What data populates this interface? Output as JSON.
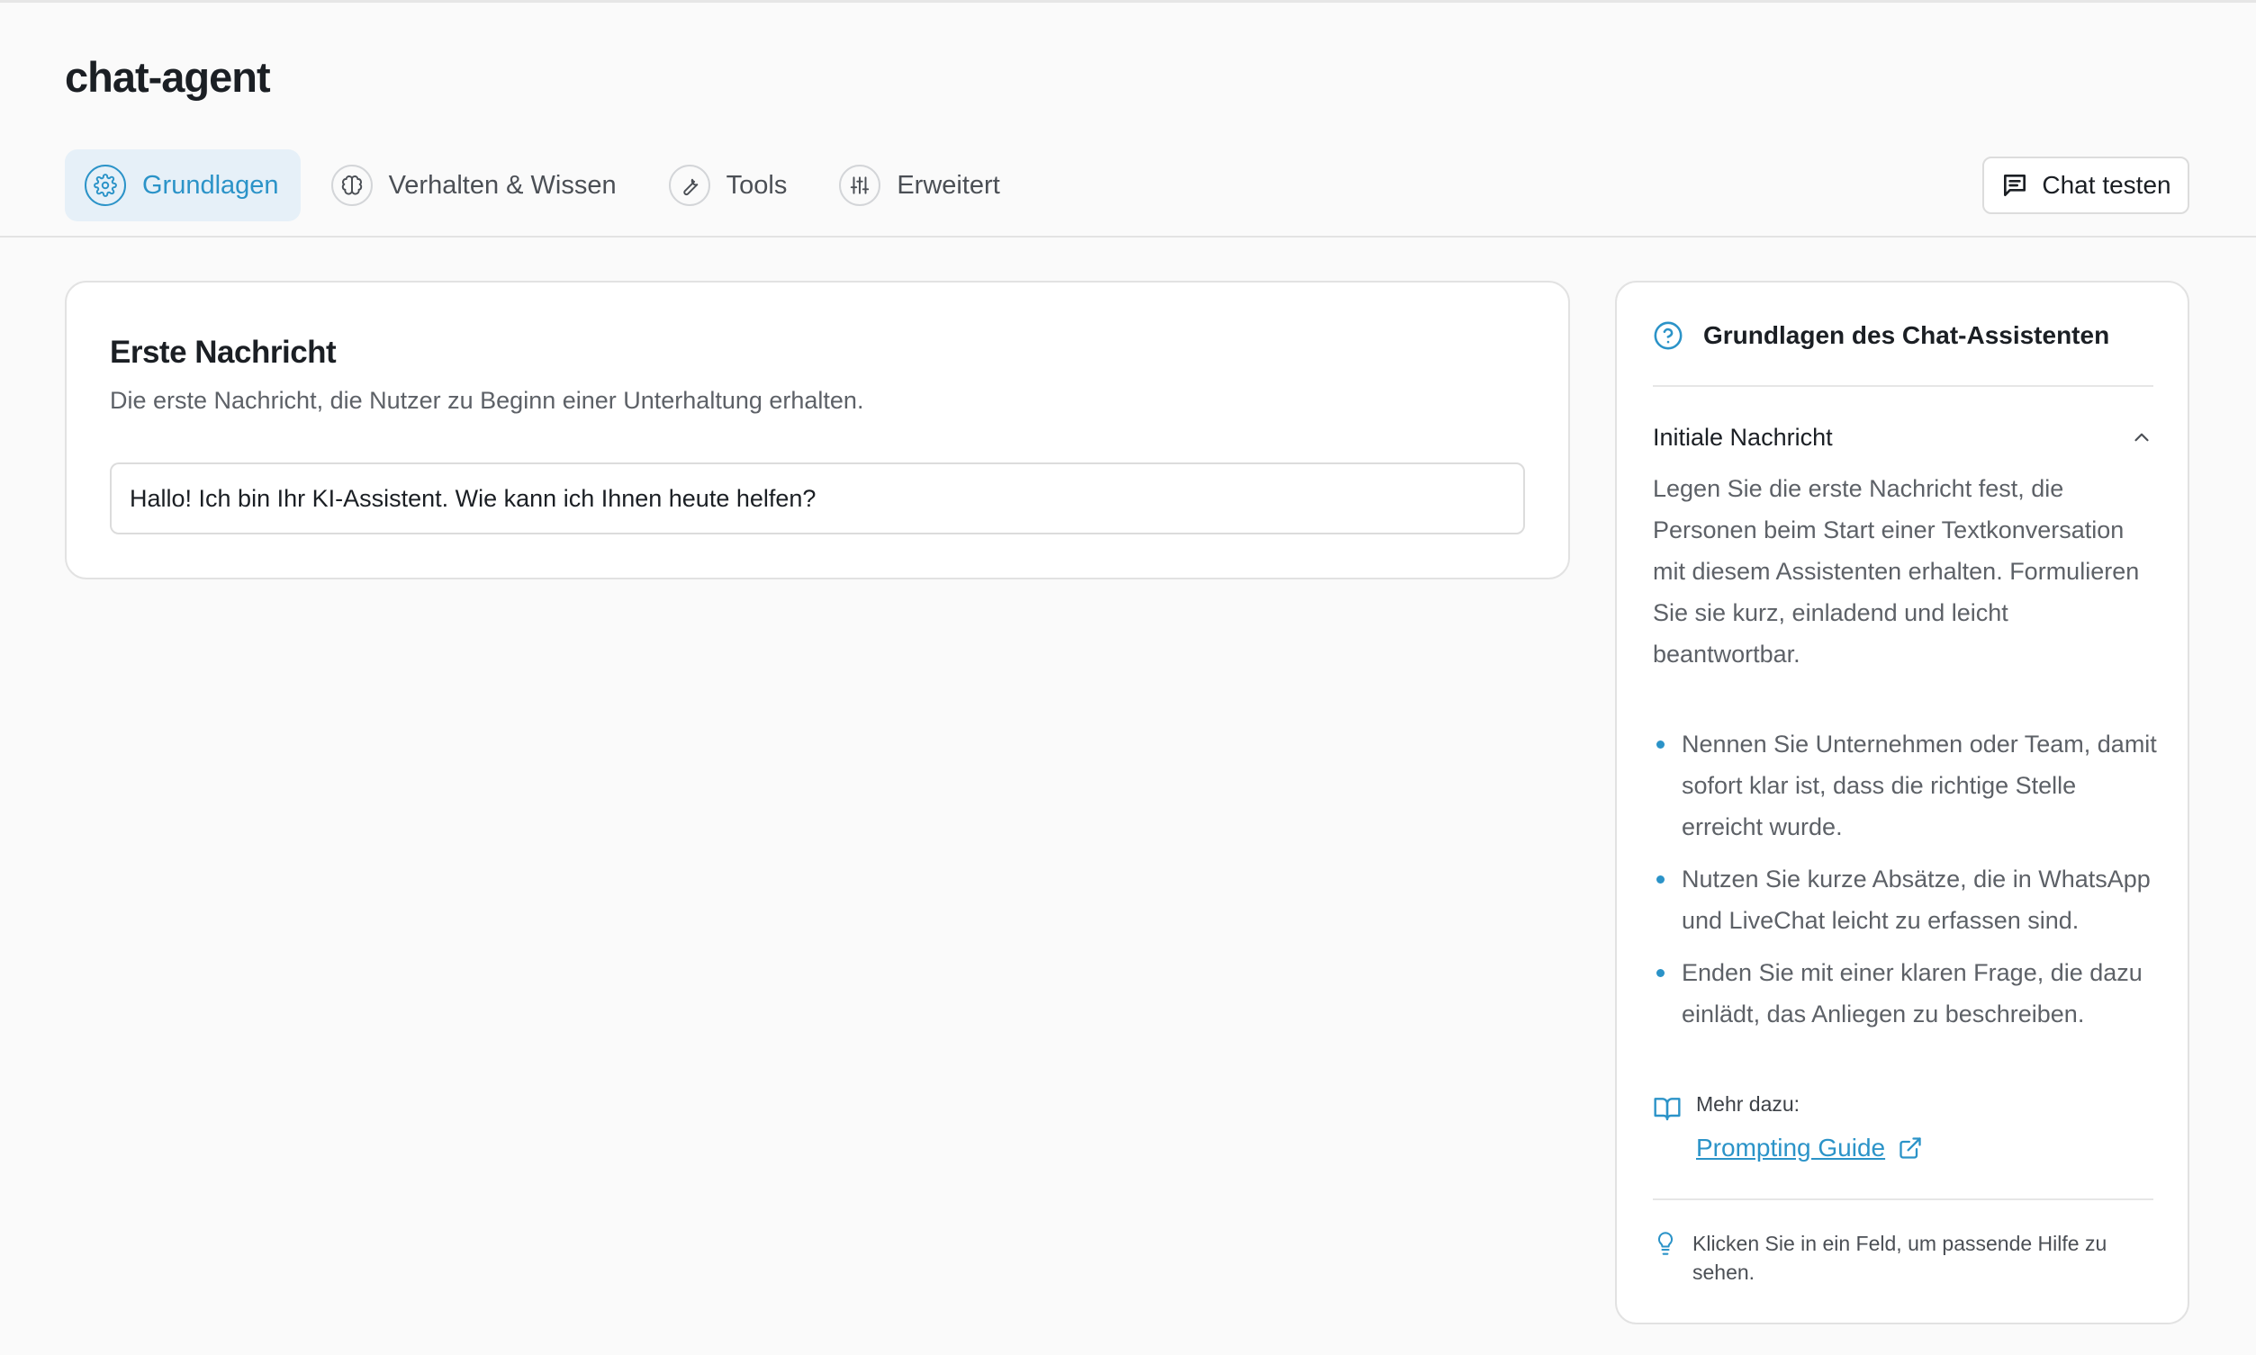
{
  "app": {
    "title": "chat-agent"
  },
  "tabs": [
    {
      "label": "Grundlagen",
      "icon": "gear-icon",
      "active": true
    },
    {
      "label": "Verhalten & Wissen",
      "icon": "brain-icon",
      "active": false
    },
    {
      "label": "Tools",
      "icon": "wrench-icon",
      "active": false
    },
    {
      "label": "Erweitert",
      "icon": "sliders-icon",
      "active": false
    }
  ],
  "actions": {
    "chat_test_label": "Chat testen",
    "chat_test_icon": "chat-icon"
  },
  "card": {
    "title": "Erste Nachricht",
    "description": "Die erste Nachricht, die Nutzer zu Beginn einer Unterhaltung erhalten.",
    "message_value": "Hallo! Ich bin Ihr KI-Assistent. Wie kann ich Ihnen heute helfen?"
  },
  "help": {
    "title": "Grundlagen des Chat-Assistenten",
    "section_title": "Initiale Nachricht",
    "section_text": "Legen Sie die erste Nachricht fest, die Personen beim Start einer Textkonversation mit diesem Assistenten erhalten. Formulieren Sie sie kurz, einladend und leicht beantwortbar.",
    "bullets": [
      "Nennen Sie Unternehmen oder Team, damit sofort klar ist, dass die richtige Stelle erreicht wurde.",
      "Nutzen Sie kurze Absätze, die in WhatsApp und LiveChat leicht zu erfassen sind.",
      "Enden Sie mit einer klaren Frage, die dazu einlädt, das Anliegen zu beschreiben."
    ],
    "more_label": "Mehr dazu:",
    "guide_link": "Prompting Guide",
    "hint": "Klicken Sie in ein Feld, um passende Hilfe zu sehen."
  },
  "colors": {
    "accent": "#2b93c8",
    "active_tab_bg": "#e6f0f8",
    "page_bg": "#fafafa"
  }
}
